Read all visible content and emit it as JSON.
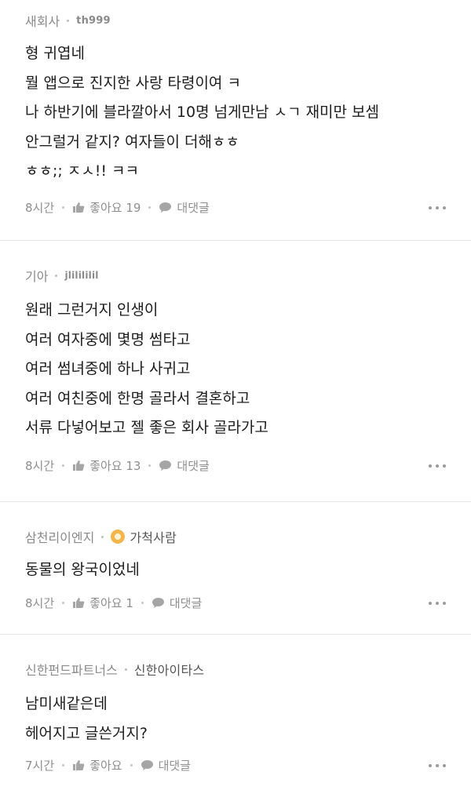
{
  "comments": [
    {
      "company": "새회사",
      "nickname": "th999",
      "lines": [
        "형 귀엽네",
        "뭘 앱으로 진지한 사랑 타령이여 ㅋ",
        "나 하반기에 블라깔아서 10명 넘게만남 ㅅㄱ 재미만 보셈",
        "안그럴거 같지? 여자들이 더해ㅎㅎ",
        "ㅎㅎ;; ㅈㅅ!! ㅋㅋ"
      ],
      "time": "8시간",
      "like_label": "좋아요 19",
      "reply_label": "대댓글"
    },
    {
      "company": "기아",
      "nickname": "jlilililil",
      "lines": [
        "원래 그런거지 인생이",
        "여러 여자중에 몇명 썸타고",
        "여러 썸녀중에 하나 사귀고",
        "여러 여친중에 한명 골라서 결혼하고",
        "서류 다넣어보고 젤 좋은 회사 골라가고"
      ],
      "time": "8시간",
      "like_label": "좋아요 13",
      "reply_label": "대댓글"
    },
    {
      "company": "삼천리이엔지",
      "nickname": "가척사람",
      "lines": [
        "동물의 왕국이었네"
      ],
      "time": "8시간",
      "like_label": "좋아요 1",
      "reply_label": "대댓글"
    },
    {
      "company": "신한펀드파트너스",
      "nickname": "신한아이타스",
      "lines": [
        "남미새같은데",
        "헤어지고 글쓴거지?"
      ],
      "time": "7시간",
      "like_label": "좋아요",
      "reply_label": "대댓글"
    }
  ]
}
